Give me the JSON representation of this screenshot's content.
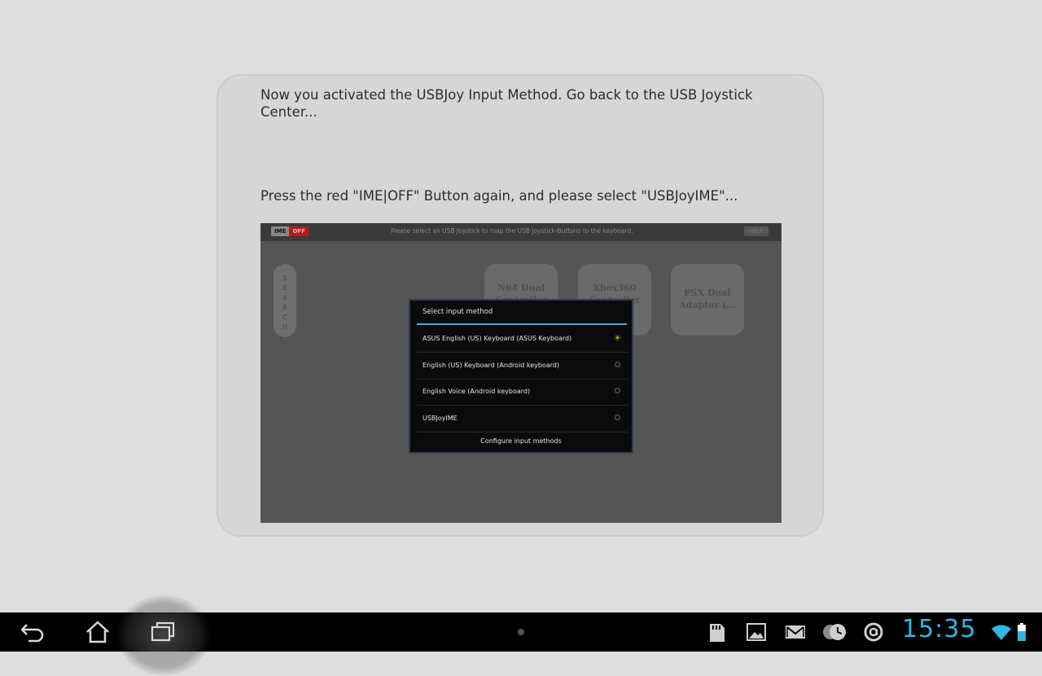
{
  "tutorial": {
    "paragraph1": "Now you activated the USBJoy Input Method. Go back to the USB Joystick Center...",
    "paragraph2": "Press the red \"IME|OFF\" Button again, and please select \"USBJoyIME\"..."
  },
  "screenshot": {
    "ime_label": "IME",
    "off_label": "OFF",
    "hint_text": "Please select an USB Joystick to map the USB Joystick-Buttons to the keyboard.",
    "help_label": "HELP",
    "search_letters": "S E A R C H",
    "tiles": [
      {
        "label": "N64 Dual Controller"
      },
      {
        "label": "Xbox360 Controller"
      },
      {
        "label": "PSX Dual Adaptor (..."
      }
    ],
    "dialog": {
      "title": "Select input method",
      "options": [
        {
          "label": "ASUS English (US) Keyboard (ASUS Keyboard)",
          "selected": true
        },
        {
          "label": "English (US) Keyboard (Android keyboard)",
          "selected": false
        },
        {
          "label": "English Voice (Android keyboard)",
          "selected": false
        },
        {
          "label": "USBJoyIME",
          "selected": false
        }
      ],
      "configure_label": "Configure input methods"
    }
  },
  "navbar": {
    "back_icon": "back-icon",
    "home_icon": "home-icon",
    "recent_icon": "recent-apps-icon",
    "status_icons": [
      "sd-card-icon",
      "gallery-icon",
      "gmail-icon",
      "clock-app-icon",
      "asus-sync-icon"
    ],
    "time": "15:35",
    "accent": "#33b5e5"
  }
}
